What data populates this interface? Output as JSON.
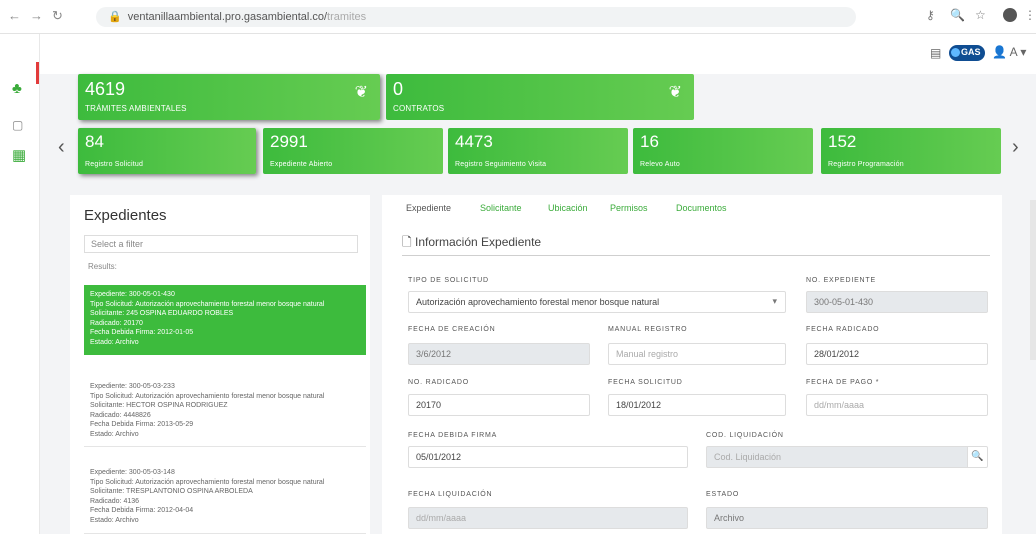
{
  "browser": {
    "url_domain": "ventanillaambiental.pro.gasambiental.co/",
    "url_path": "tramites"
  },
  "header": {
    "user_menu_label": "A"
  },
  "summary_cards": [
    {
      "value": "4619",
      "label": "TRÁMITES AMBIENTALES"
    },
    {
      "value": "0",
      "label": "CONTRATOS"
    }
  ],
  "status_cards": [
    {
      "value": "84",
      "label": "Registro Solicitud"
    },
    {
      "value": "2991",
      "label": "Expediente Abierto"
    },
    {
      "value": "4473",
      "label": "Registro Seguimiento Visita"
    },
    {
      "value": "16",
      "label": "Relevo Auto"
    },
    {
      "value": "152",
      "label": "Registro Programación"
    }
  ],
  "left_panel": {
    "title": "Expedientes",
    "filter_placeholder": "Select a filter",
    "results_label": "Results:",
    "items": [
      {
        "expediente": "Expediente: 300-05-01-430",
        "tipo": "Tipo Solicitud: Autorización aprovechamiento forestal menor bosque natural",
        "solicitante": "Solicitante: 245 OSPINA EDUARDO ROBLES",
        "radicado": "Radicado: 20170",
        "fecha_firma": "Fecha Debida Firma: 2012-01-05",
        "estado": "Estado: Archivo"
      },
      {
        "expediente": "Expediente: 300-05-03-233",
        "tipo": "Tipo Solicitud: Autorización aprovechamiento forestal menor bosque natural",
        "solicitante": "Solicitante: HECTOR OSPINA RODRIGUEZ",
        "radicado": "Radicado: 4448826",
        "fecha_firma": "Fecha Debida Firma: 2013-05-29",
        "estado": "Estado: Archivo"
      },
      {
        "expediente": "Expediente: 300-05-03-148",
        "tipo": "Tipo Solicitud: Autorización aprovechamiento forestal menor bosque natural",
        "solicitante": "Solicitante: TRESPLANTONIO OSPINA ARBOLEDA",
        "radicado": "Radicado: 4136",
        "fecha_firma": "Fecha Debida Firma: 2012-04-04",
        "estado": "Estado: Archivo"
      }
    ]
  },
  "right_panel": {
    "tabs": [
      "Expediente",
      "Solicitante",
      "Ubicación",
      "Permisos",
      "Documentos"
    ],
    "section_title": "Información Expediente",
    "fields": {
      "tipo_solicitud": {
        "label": "TIPO DE SOLICITUD",
        "value": "Autorización aprovechamiento forestal menor bosque natural"
      },
      "no_expediente": {
        "label": "NO. EXPEDIENTE",
        "value": "300-05-01-430"
      },
      "fecha_creacion": {
        "label": "FECHA DE CREACIÓN",
        "value": "3/6/2012"
      },
      "manual_registro": {
        "label": "MANUAL REGISTRO",
        "value": "",
        "placeholder": "Manual registro"
      },
      "fecha_radicado": {
        "label": "FECHA RADICADO",
        "value": "28/01/2012"
      },
      "no_radicado": {
        "label": "NO. RADICADO",
        "value": "20170"
      },
      "fecha_solicitud": {
        "label": "FECHA SOLICITUD",
        "value": "18/01/2012"
      },
      "fecha_pago": {
        "label": "FECHA DE PAGO *",
        "value": "",
        "placeholder": "dd/mm/aaaa"
      },
      "fecha_debida_firma": {
        "label": "FECHA DEBIDA FIRMA",
        "value": "05/01/2012"
      },
      "cod_liquidacion": {
        "label": "COD. LIQUIDACIÓN",
        "value": "",
        "placeholder": "Cod. Liquidación"
      },
      "fecha_liquidacion": {
        "label": "FECHA LIQUIDACIÓN",
        "value": "",
        "placeholder": "dd/mm/aaaa"
      },
      "estado": {
        "label": "ESTADO",
        "value": "Archivo"
      }
    }
  },
  "icons": {
    "back": "back-arrow-icon",
    "forward": "forward-arrow-icon",
    "reload": "reload-icon",
    "lock": "lock-icon",
    "carousel_prev": "chevron-left-icon",
    "carousel_next": "chevron-right-icon"
  },
  "colors": {
    "primary_green": "#3dbb3d",
    "light_green": "#66cc52",
    "readonly_gray": "#e6e9ec",
    "active_marker": "#e23b3b"
  }
}
